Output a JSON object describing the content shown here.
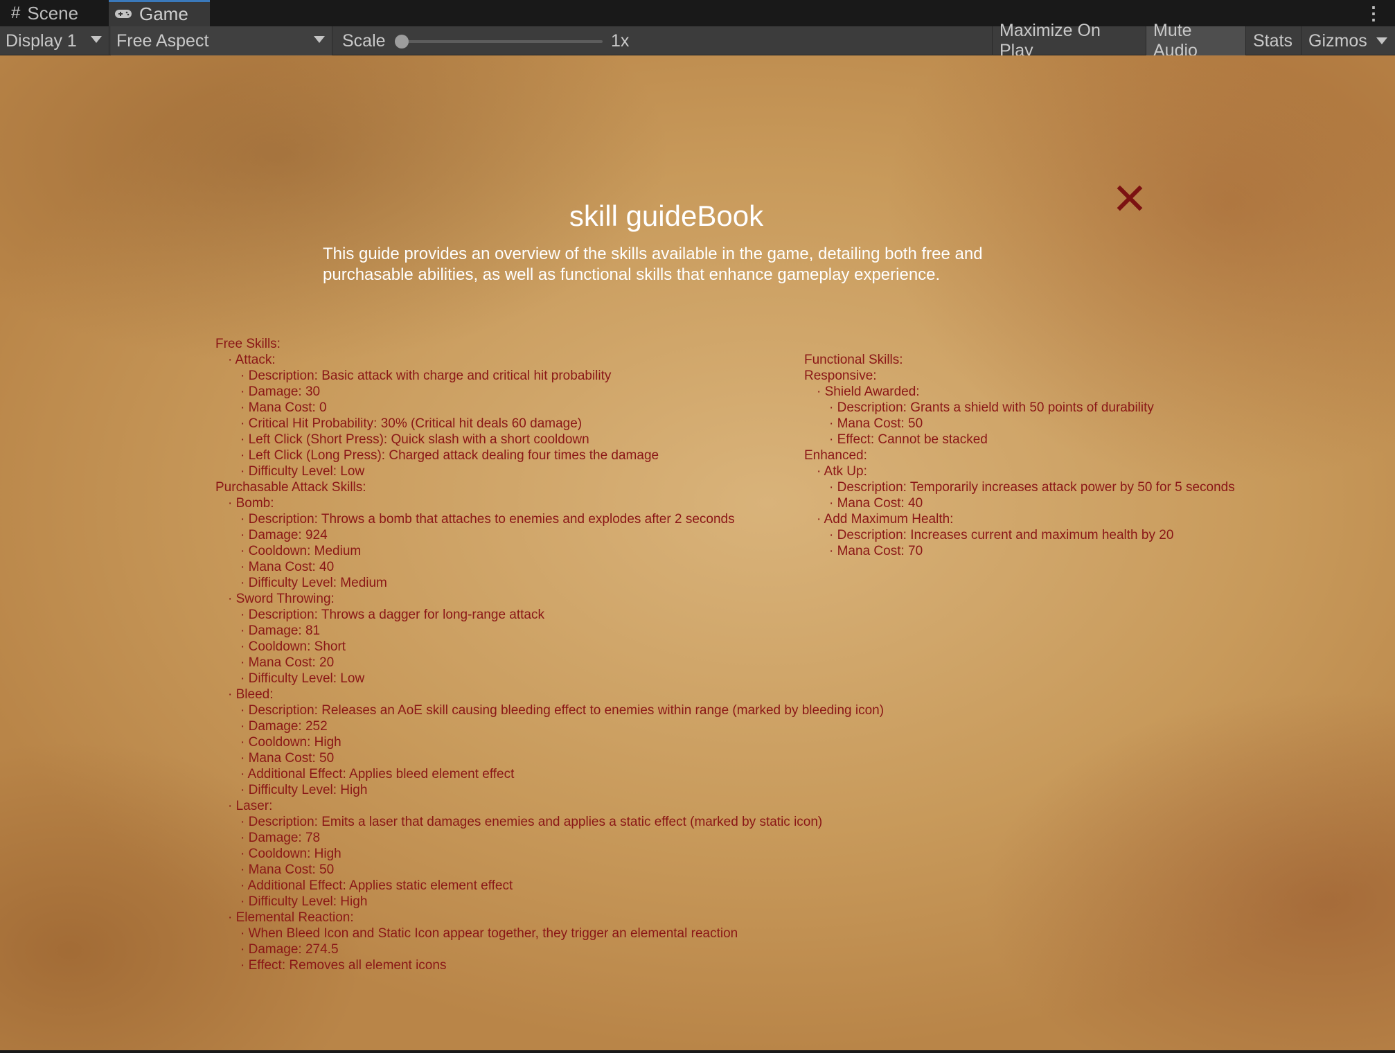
{
  "editor": {
    "tabs": [
      {
        "label": "Scene",
        "icon": "hash-icon"
      },
      {
        "label": "Game",
        "icon": "gamepad-icon"
      }
    ],
    "toolbar": {
      "display": "Display 1",
      "aspect": "Free Aspect",
      "scale_label": "Scale",
      "scale_value": "1x",
      "maximize": "Maximize On Play",
      "mute": "Mute Audio",
      "stats": "Stats",
      "gizmos": "Gizmos"
    }
  },
  "guide": {
    "title": "skill guideBook",
    "intro": "This guide provides an overview of the skills available in the game, detailing both free and purchasable abilities, as well as functional skills that enhance gameplay experience.",
    "left_lines": [
      "Free Skills:",
      "· Attack:",
      "· Description: Basic attack with charge and critical hit probability",
      "· Damage: 30",
      "· Mana Cost: 0",
      "· Critical Hit Probability: 30% (Critical hit deals 60 damage)",
      "· Left Click (Short Press): Quick slash with a short cooldown",
      "· Left Click (Long Press): Charged attack dealing four times the damage",
      "· Difficulty Level: Low",
      "Purchasable Attack Skills:",
      "· Bomb:",
      "· Description: Throws a bomb that attaches to enemies and explodes after 2 seconds",
      "· Damage: 924",
      "· Cooldown: Medium",
      "· Mana Cost: 40",
      "· Difficulty Level: Medium",
      "· Sword Throwing:",
      "· Description: Throws a dagger for long-range attack",
      "· Damage: 81",
      "· Cooldown: Short",
      "· Mana Cost: 20",
      "· Difficulty Level: Low",
      "· Bleed:",
      "· Description: Releases an AoE skill causing bleeding effect to enemies within range (marked by bleeding icon)",
      "· Damage: 252",
      "· Cooldown: High",
      "· Mana Cost: 50",
      "· Additional Effect: Applies bleed element effect",
      "· Difficulty Level: High",
      "· Laser:",
      "· Description: Emits a laser that damages enemies and applies a static effect (marked by static icon)",
      "· Damage: 78",
      "· Cooldown: High",
      "· Mana Cost: 50",
      "· Additional Effect: Applies static element effect",
      "· Difficulty Level: High",
      "· Elemental Reaction:",
      "· When Bleed Icon and Static Icon appear together, they trigger an elemental reaction",
      "· Damage: 274.5",
      "· Effect: Removes all element icons"
    ],
    "right_lines": [
      "Functional Skills:",
      "Responsive:",
      "· Shield Awarded:",
      "· Description: Grants a shield with 50 points of durability",
      "· Mana Cost: 50",
      "· Effect: Cannot be stacked",
      "Enhanced:",
      "· Atk Up:",
      "· Description: Temporarily increases attack power by 50 for 5 seconds",
      "· Mana Cost: 40",
      "· Add Maximum Health:",
      "· Description: Increases current and maximum health by 20",
      "· Mana Cost: 70"
    ]
  }
}
